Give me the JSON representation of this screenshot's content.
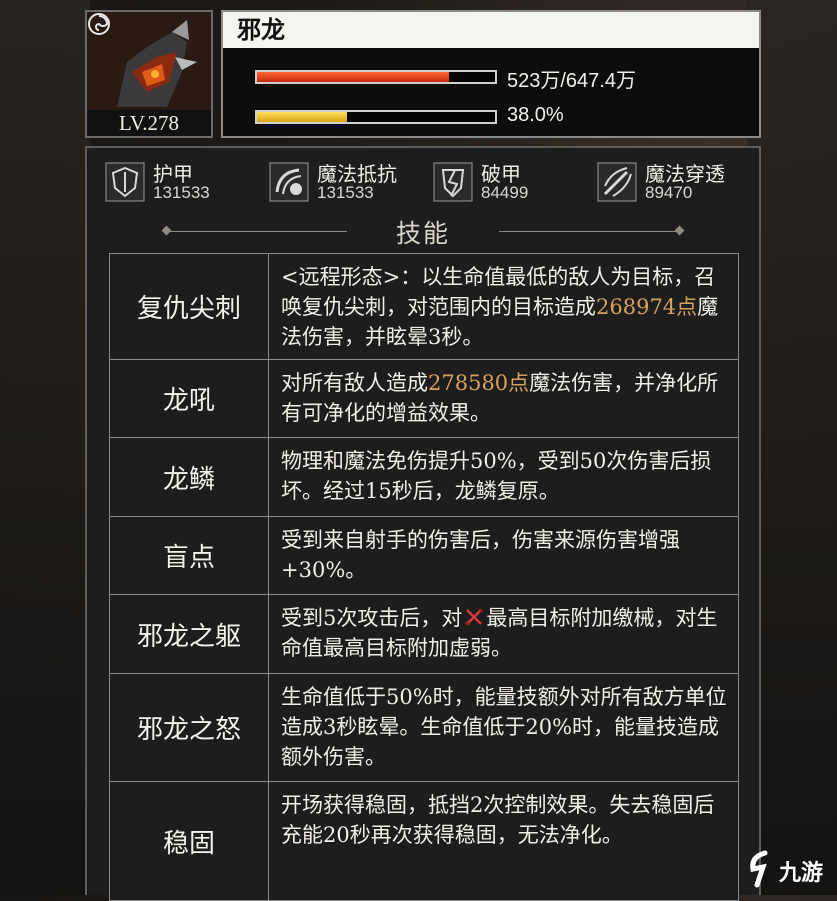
{
  "unit": {
    "name": "邪龙",
    "level": "LV.278",
    "hp_text": "523万/647.4万",
    "hp_ratio": 0.808,
    "energy_text": "38.0%",
    "energy_ratio": 0.38,
    "hp_color": "#e0441c",
    "energy_color": "#f0c22a",
    "class_icon": "mage-swirl-icon"
  },
  "stats": [
    {
      "label": "护甲",
      "value": "131533",
      "icon": "armor-shield-icon"
    },
    {
      "label": "魔法抵抗",
      "value": "131533",
      "icon": "magic-resist-icon"
    },
    {
      "label": "破甲",
      "value": "84499",
      "icon": "armor-break-icon"
    },
    {
      "label": "魔法穿透",
      "value": "89470",
      "icon": "magic-penetration-icon"
    }
  ],
  "section_title": "技能",
  "skills": [
    {
      "name": "复仇尖刺",
      "pre": "<远程形态>：以生命值最低的敌人为目标，召唤复仇尖刺，对范围内的目标造成",
      "hl": "268974点",
      "post": "魔法伤害，并眩晕3秒。"
    },
    {
      "name": "龙吼",
      "pre": "对所有敌人造成",
      "hl": "278580点",
      "post": "魔法伤害，并净化所有可净化的增益效果。"
    },
    {
      "name": "龙鳞",
      "pre": "物理和魔法免伤提升50%，受到50次伤害后损坏。经过15秒后，龙鳞复原。",
      "hl": "",
      "post": ""
    },
    {
      "name": "盲点",
      "pre": "受到来自射手的伤害后，伤害来源伤害增强+30%。",
      "hl": "",
      "post": ""
    },
    {
      "name": "邪龙之躯",
      "pre": "受到5次攻击后，对",
      "icon": "crossed-swords-icon",
      "post": "最高目标附加缴械，对生命值最高目标附加虚弱。"
    },
    {
      "name": "邪龙之怒",
      "pre": "生命值低于50%时，能量技额外对所有敌方单位造成3秒眩晕。生命值低于20%时，能量技造成额外伤害。",
      "hl": "",
      "post": ""
    },
    {
      "name": "稳固",
      "pre": "开场获得稳固，抵挡2次控制效果。失去稳固后充能20秒再次获得稳固，无法净化。",
      "hl": "",
      "post": ""
    }
  ],
  "watermark": {
    "text": "九游",
    "icon": "jiuyou-logo-icon"
  }
}
